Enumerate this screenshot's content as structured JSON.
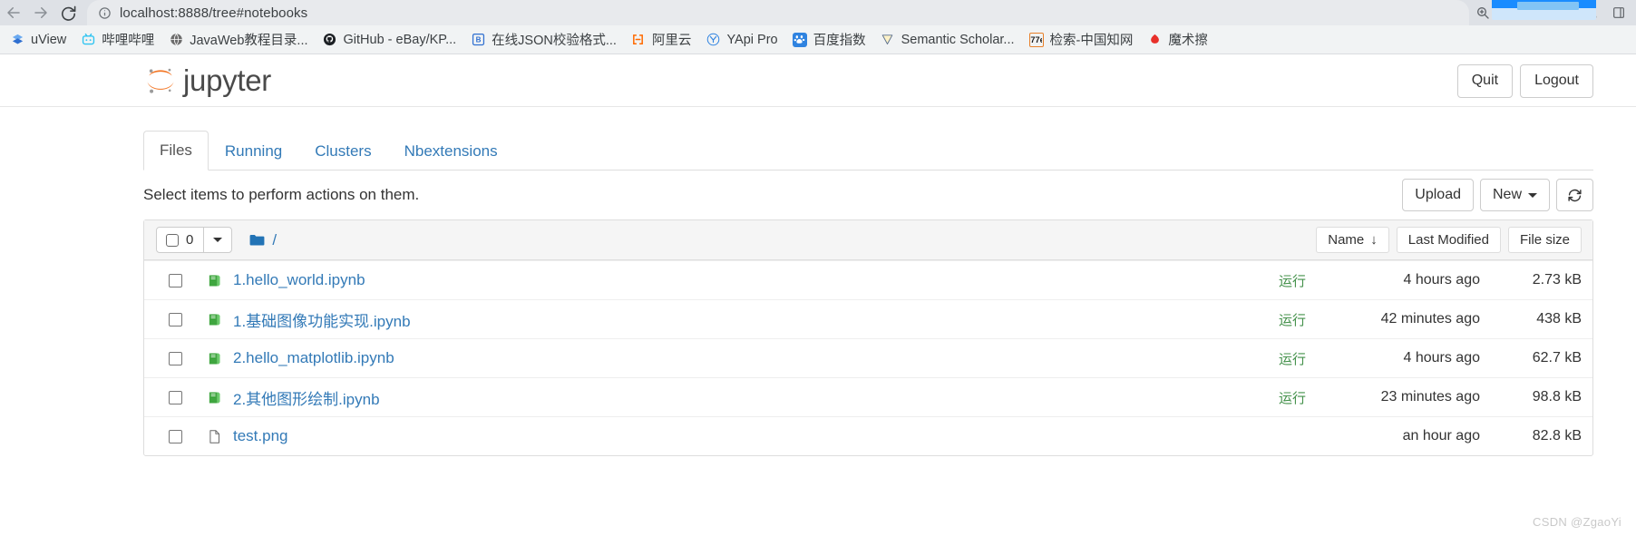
{
  "browser": {
    "url": "localhost:8888/tree#notebooks",
    "nav": {
      "back_label": "Back",
      "forward_label": "Forward",
      "reload_label": "Reload"
    },
    "omnibox_icons": [
      "site-info-icon",
      "zoom-icon",
      "share-icon",
      "bookmark-star-icon",
      "extension-icon",
      "profile-icon",
      "sidepanel-icon"
    ],
    "bookmarks": [
      {
        "label": "uView",
        "icon": "uview-icon",
        "icon_glyph": "◆",
        "icon_bg": "#ffffff",
        "icon_color": "#2f83e0"
      },
      {
        "label": "哔哩哔哩",
        "icon": "bilibili-icon",
        "icon_glyph": "□",
        "icon_bg": "#ffffff",
        "icon_color": "#2ec4f1"
      },
      {
        "label": "JavaWeb教程目录...",
        "icon": "globe-icon",
        "icon_glyph": "●",
        "icon_bg": "#ffffff",
        "icon_color": "#6d6d6d"
      },
      {
        "label": "GitHub - eBay/KP...",
        "icon": "github-icon",
        "icon_glyph": "●",
        "icon_bg": "#ffffff",
        "icon_color": "#1b1f23"
      },
      {
        "label": "在线JSON校验格式...",
        "icon": "json-icon",
        "icon_glyph": "B",
        "icon_bg": "#ffffff",
        "icon_color": "#2f6fd0"
      },
      {
        "label": "阿里云",
        "icon": "aliyun-icon",
        "icon_glyph": "[-]",
        "icon_bg": "#ffffff",
        "icon_color": "#ff6a00"
      },
      {
        "label": "YApi Pro",
        "icon": "yapi-icon",
        "icon_glyph": "Y",
        "icon_bg": "#ffffff",
        "icon_color": "#2f83e0"
      },
      {
        "label": "百度指数",
        "icon": "baidu-icon",
        "icon_glyph": "熊",
        "icon_bg": "#2f83e0",
        "icon_color": "#ffffff"
      },
      {
        "label": "Semantic Scholar...",
        "icon": "semantic-scholar-icon",
        "icon_glyph": "▽",
        "icon_bg": "#ffffff",
        "icon_color": "#f5c518"
      },
      {
        "label": "检索-中国知网",
        "icon": "cnki-icon",
        "icon_glyph": "知",
        "icon_bg": "#ffffff",
        "icon_color": "#1b1b1b"
      },
      {
        "label": "魔术擦",
        "icon": "magic-eraser-icon",
        "icon_glyph": "●",
        "icon_bg": "#ffffff",
        "icon_color": "#e8302a"
      }
    ]
  },
  "header": {
    "logo_text": "jupyter",
    "quit_label": "Quit",
    "logout_label": "Logout"
  },
  "tabs": [
    {
      "label": "Files",
      "active": true
    },
    {
      "label": "Running",
      "active": false
    },
    {
      "label": "Clusters",
      "active": false
    },
    {
      "label": "Nbextensions",
      "active": false
    }
  ],
  "toolbar": {
    "select_hint": "Select items to perform actions on them.",
    "upload_label": "Upload",
    "new_label": "New",
    "refresh_label": "⟳"
  },
  "list_header": {
    "selected_count": "0",
    "breadcrumb_root": "/",
    "sort_name": "Name",
    "sort_name_arrow": "↓",
    "sort_modified": "Last Modified",
    "sort_size": "File size"
  },
  "files": [
    {
      "name": "1.hello_world.ipynb",
      "icon": "notebook-icon",
      "type": "notebook",
      "running_label": "运行",
      "modified": "4 hours ago",
      "size": "2.73 kB"
    },
    {
      "name": "1.基础图像功能实现.ipynb",
      "icon": "notebook-icon",
      "type": "notebook",
      "running_label": "运行",
      "modified": "42 minutes ago",
      "size": "438 kB"
    },
    {
      "name": "2.hello_matplotlib.ipynb",
      "icon": "notebook-icon",
      "type": "notebook",
      "running_label": "运行",
      "modified": "4 hours ago",
      "size": "62.7 kB"
    },
    {
      "name": "2.其他图形绘制.ipynb",
      "icon": "notebook-icon",
      "type": "notebook",
      "running_label": "运行",
      "modified": "23 minutes ago",
      "size": "98.8 kB"
    },
    {
      "name": "test.png",
      "icon": "file-icon",
      "type": "file",
      "running_label": "",
      "modified": "an hour ago",
      "size": "82.8 kB"
    }
  ],
  "watermark": "CSDN @ZgaoYi",
  "colors": {
    "link_blue": "#337ab7",
    "notebook_green": "#44aa44",
    "running_green": "#44914b",
    "folder_blue": "#2273b5",
    "jupyter_orange": "#f37726"
  }
}
